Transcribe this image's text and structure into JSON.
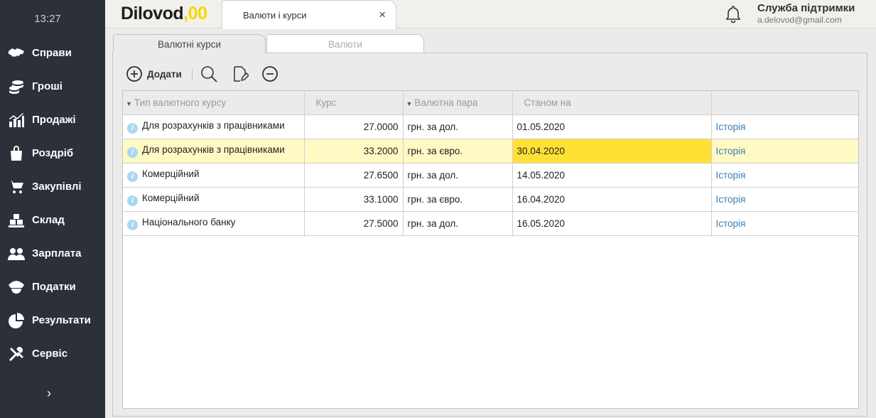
{
  "sidebar": {
    "time": "13:27",
    "items": [
      {
        "label": "Справи",
        "icon": "handshake-icon"
      },
      {
        "label": "Гроші",
        "icon": "coins-icon"
      },
      {
        "label": "Продажі",
        "icon": "chart-icon"
      },
      {
        "label": "Роздріб",
        "icon": "shopping-bag-icon"
      },
      {
        "label": "Закупівлі",
        "icon": "cart-icon"
      },
      {
        "label": "Склад",
        "icon": "boxes-icon"
      },
      {
        "label": "Зарплата",
        "icon": "people-icon"
      },
      {
        "label": "Податки",
        "icon": "officer-cap-icon"
      },
      {
        "label": "Результати",
        "icon": "pie-chart-icon"
      },
      {
        "label": "Сервіс",
        "icon": "tools-icon"
      }
    ],
    "expand_glyph": "›"
  },
  "header": {
    "logo_text": "Dilovod",
    "logo_suffix": ",00",
    "tab_label": "Валюти і курси",
    "tab_close": "×",
    "support_title": "Служба підтримки",
    "support_email": "a.delovod@gmail.com"
  },
  "subtabs": [
    "Валютні курси",
    "Валюти"
  ],
  "toolbar": {
    "add_label": "Додати"
  },
  "table": {
    "columns": [
      "Тип валютного курсу",
      "Курс",
      "Валютна пара",
      "Станом на",
      ""
    ],
    "rows": [
      {
        "type": "Для розрахунків з працівниками",
        "rate": "27.0000",
        "pair": "грн. за дол.",
        "date": "01.05.2020",
        "link": "Історія"
      },
      {
        "type": "Для розрахунків з працівниками",
        "rate": "33.2000",
        "pair": "грн. за євро.",
        "date": "30.04.2020",
        "link": "Історія"
      },
      {
        "type": "Комерційний",
        "rate": "27.6500",
        "pair": "грн. за дол.",
        "date": "14.05.2020",
        "link": "Історія"
      },
      {
        "type": "Комерційний",
        "rate": "33.1000",
        "pair": "грн. за євро.",
        "date": "16.04.2020",
        "link": "Історія"
      },
      {
        "type": "Національного банку",
        "rate": "27.5000",
        "pair": "грн. за дол.",
        "date": "16.05.2020",
        "link": "Історія"
      }
    ]
  },
  "colors": {
    "sidebar_bg": "#2c3038",
    "accent_yellow": "#ffe135",
    "selected_row": "#fff9c4",
    "link": "#3a7fb5"
  }
}
